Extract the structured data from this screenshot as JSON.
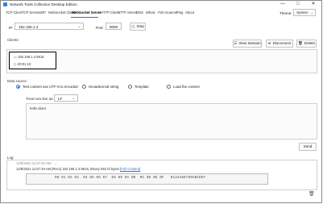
{
  "window": {
    "title": "Network Tools Collection Desktop Edition",
    "controls": {
      "minimize": "—",
      "maximize": "□",
      "close": "✕"
    }
  },
  "tabs": [
    {
      "label": "TCP Client"
    },
    {
      "label": "TCP Server"
    },
    {
      "label": "UDP"
    },
    {
      "label": "WebSocket Client"
    },
    {
      "label": "WebSocket Server"
    },
    {
      "label": "HTTP Client"
    },
    {
      "label": "HTTP Server"
    },
    {
      "label": "DNS"
    },
    {
      "label": "Whois"
    },
    {
      "label": "Port Scanner"
    },
    {
      "label": "Ping"
    },
    {
      "label": "About"
    }
  ],
  "active_tab": "WebSocket Server",
  "theme": {
    "label": "Theme:",
    "value": "System"
  },
  "server": {
    "ip_label": "IP:",
    "ip_value": "192.168.1.4",
    "port_label": "Port:",
    "port_value": "8080",
    "stop_label": "Stop"
  },
  "clients": {
    "label": "Clients:",
    "view_session": "View Session",
    "disconnect": "Disconnect",
    "delete": "Delete",
    "items": [
      {
        "address": "192.168.1.4:9615",
        "time": "00:01:10"
      }
    ]
  },
  "data_source": {
    "label": "Data source:",
    "options": [
      {
        "label": "Text content use UTF-8 to encoded",
        "selected": true
      },
      {
        "label": "Hexadecimal string",
        "selected": false
      },
      {
        "label": "Template",
        "selected": false
      },
      {
        "label": "Load the content",
        "selected": false
      }
    ],
    "treat_label": "Treat new line as:",
    "treat_value": "LF",
    "content": "hello client",
    "send_label": "Send"
  },
  "log": {
    "label": "Log:",
    "line1": "12/8/2021 11:57:20 AM - ...",
    "line2": "12/8/2021 11:57:29 AM  [Recv] 192.168.1.4:9615, Binary 65172 bytes",
    "link": "[Full Content]",
    "hex": "00 01 02 03  04 05 06 07  08 09 0A 0B  0C 0D 0E 0F   0123456789ABCDEF"
  },
  "icons": {
    "client": "monitor-icon",
    "time": "clock-icon",
    "stop": "stop-icon",
    "view": "list-icon",
    "disconnect": "disconnect-icon",
    "delete": "trash-icon",
    "clear_log": "trash-icon"
  }
}
